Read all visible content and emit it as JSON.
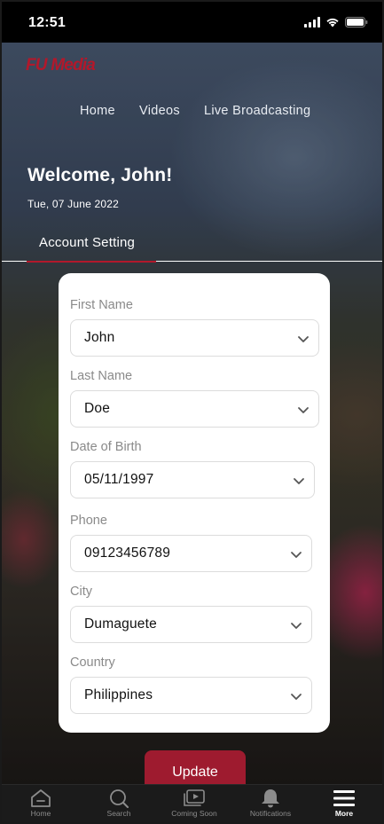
{
  "status_bar": {
    "time": "12:51"
  },
  "header": {
    "logo": "FU Media",
    "nav": [
      "Home",
      "Videos",
      "Live Broadcasting"
    ]
  },
  "welcome": {
    "greeting": "Welcome, John!",
    "date": "Tue, 07 June 2022"
  },
  "tabs": {
    "active": "Account Setting"
  },
  "form": {
    "fields": [
      {
        "label": "First Name",
        "value": "John"
      },
      {
        "label": "Last Name",
        "value": "Doe"
      },
      {
        "label": "Date of Birth",
        "value": "05/11/1997"
      },
      {
        "label": "Phone",
        "value": "09123456789"
      },
      {
        "label": "City",
        "value": "Dumaguete"
      },
      {
        "label": "Country",
        "value": "Philippines"
      }
    ],
    "submit_label": "Update"
  },
  "tabbar": {
    "items": [
      {
        "label": "Home",
        "icon": "home-icon"
      },
      {
        "label": "Search",
        "icon": "search-icon"
      },
      {
        "label": "Coming Soon",
        "icon": "coming-soon-icon"
      },
      {
        "label": "Notifications",
        "icon": "bell-icon"
      },
      {
        "label": "More",
        "icon": "menu-icon"
      }
    ],
    "active": "More"
  },
  "colors": {
    "brand_red": "#b2182b",
    "button_red": "#9e1b2f",
    "tabbar_bg": "#1b1b1b"
  }
}
